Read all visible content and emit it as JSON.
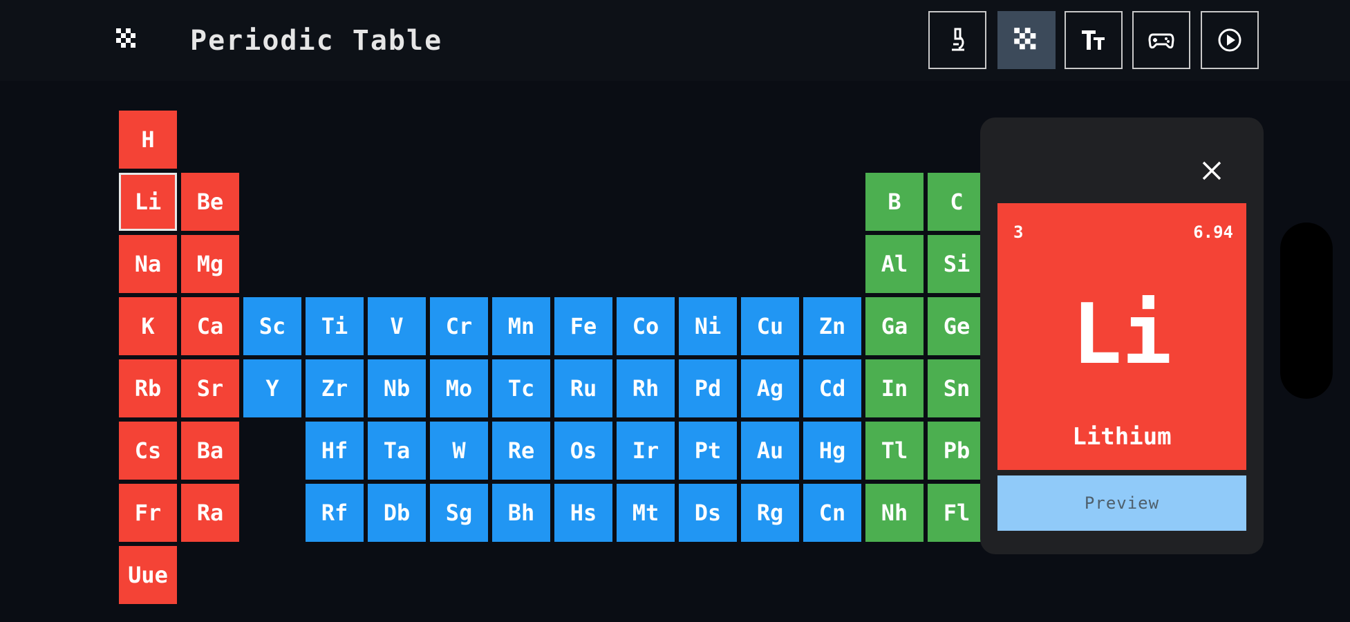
{
  "app": {
    "title": "Periodic Table"
  },
  "toolbar": {
    "buttons": [
      {
        "name": "lab-button",
        "icon": "microscope-icon",
        "active": false
      },
      {
        "name": "table-button",
        "icon": "grid-icon",
        "active": true
      },
      {
        "name": "text-size-button",
        "icon": "text-size-icon",
        "active": false
      },
      {
        "name": "game-button",
        "icon": "gamepad-icon",
        "active": false
      },
      {
        "name": "play-button",
        "icon": "play-circle-icon",
        "active": false
      }
    ]
  },
  "colors": {
    "alkali": "#f44336",
    "transition": "#2196f3",
    "post": "#4caf50",
    "selected_outline": "#e8e8e8"
  },
  "elements": [
    {
      "symbol": "H",
      "group": "alkali",
      "col": 1,
      "row": 1
    },
    {
      "symbol": "Li",
      "group": "alkali",
      "col": 1,
      "row": 2,
      "selected": true
    },
    {
      "symbol": "Be",
      "group": "alkali",
      "col": 2,
      "row": 2
    },
    {
      "symbol": "B",
      "group": "post",
      "col": 13,
      "row": 2
    },
    {
      "symbol": "C",
      "group": "post",
      "col": 14,
      "row": 2
    },
    {
      "symbol": "Na",
      "group": "alkali",
      "col": 1,
      "row": 3
    },
    {
      "symbol": "Mg",
      "group": "alkali",
      "col": 2,
      "row": 3
    },
    {
      "symbol": "Al",
      "group": "post",
      "col": 13,
      "row": 3
    },
    {
      "symbol": "Si",
      "group": "post",
      "col": 14,
      "row": 3
    },
    {
      "symbol": "K",
      "group": "alkali",
      "col": 1,
      "row": 4
    },
    {
      "symbol": "Ca",
      "group": "alkali",
      "col": 2,
      "row": 4
    },
    {
      "symbol": "Sc",
      "group": "transition",
      "col": 3,
      "row": 4
    },
    {
      "symbol": "Ti",
      "group": "transition",
      "col": 4,
      "row": 4
    },
    {
      "symbol": "V",
      "group": "transition",
      "col": 5,
      "row": 4
    },
    {
      "symbol": "Cr",
      "group": "transition",
      "col": 6,
      "row": 4
    },
    {
      "symbol": "Mn",
      "group": "transition",
      "col": 7,
      "row": 4
    },
    {
      "symbol": "Fe",
      "group": "transition",
      "col": 8,
      "row": 4
    },
    {
      "symbol": "Co",
      "group": "transition",
      "col": 9,
      "row": 4
    },
    {
      "symbol": "Ni",
      "group": "transition",
      "col": 10,
      "row": 4
    },
    {
      "symbol": "Cu",
      "group": "transition",
      "col": 11,
      "row": 4
    },
    {
      "symbol": "Zn",
      "group": "transition",
      "col": 12,
      "row": 4
    },
    {
      "symbol": "Ga",
      "group": "post",
      "col": 13,
      "row": 4
    },
    {
      "symbol": "Ge",
      "group": "post",
      "col": 14,
      "row": 4
    },
    {
      "symbol": "Rb",
      "group": "alkali",
      "col": 1,
      "row": 5
    },
    {
      "symbol": "Sr",
      "group": "alkali",
      "col": 2,
      "row": 5
    },
    {
      "symbol": "Y",
      "group": "transition",
      "col": 3,
      "row": 5
    },
    {
      "symbol": "Zr",
      "group": "transition",
      "col": 4,
      "row": 5
    },
    {
      "symbol": "Nb",
      "group": "transition",
      "col": 5,
      "row": 5
    },
    {
      "symbol": "Mo",
      "group": "transition",
      "col": 6,
      "row": 5
    },
    {
      "symbol": "Tc",
      "group": "transition",
      "col": 7,
      "row": 5
    },
    {
      "symbol": "Ru",
      "group": "transition",
      "col": 8,
      "row": 5
    },
    {
      "symbol": "Rh",
      "group": "transition",
      "col": 9,
      "row": 5
    },
    {
      "symbol": "Pd",
      "group": "transition",
      "col": 10,
      "row": 5
    },
    {
      "symbol": "Ag",
      "group": "transition",
      "col": 11,
      "row": 5
    },
    {
      "symbol": "Cd",
      "group": "transition",
      "col": 12,
      "row": 5
    },
    {
      "symbol": "In",
      "group": "post",
      "col": 13,
      "row": 5
    },
    {
      "symbol": "Sn",
      "group": "post",
      "col": 14,
      "row": 5
    },
    {
      "symbol": "Cs",
      "group": "alkali",
      "col": 1,
      "row": 6
    },
    {
      "symbol": "Ba",
      "group": "alkali",
      "col": 2,
      "row": 6
    },
    {
      "symbol": "Hf",
      "group": "transition",
      "col": 4,
      "row": 6
    },
    {
      "symbol": "Ta",
      "group": "transition",
      "col": 5,
      "row": 6
    },
    {
      "symbol": "W",
      "group": "transition",
      "col": 6,
      "row": 6
    },
    {
      "symbol": "Re",
      "group": "transition",
      "col": 7,
      "row": 6
    },
    {
      "symbol": "Os",
      "group": "transition",
      "col": 8,
      "row": 6
    },
    {
      "symbol": "Ir",
      "group": "transition",
      "col": 9,
      "row": 6
    },
    {
      "symbol": "Pt",
      "group": "transition",
      "col": 10,
      "row": 6
    },
    {
      "symbol": "Au",
      "group": "transition",
      "col": 11,
      "row": 6
    },
    {
      "symbol": "Hg",
      "group": "transition",
      "col": 12,
      "row": 6
    },
    {
      "symbol": "Tl",
      "group": "post",
      "col": 13,
      "row": 6
    },
    {
      "symbol": "Pb",
      "group": "post",
      "col": 14,
      "row": 6
    },
    {
      "symbol": "Fr",
      "group": "alkali",
      "col": 1,
      "row": 7
    },
    {
      "symbol": "Ra",
      "group": "alkali",
      "col": 2,
      "row": 7
    },
    {
      "symbol": "Rf",
      "group": "transition",
      "col": 4,
      "row": 7
    },
    {
      "symbol": "Db",
      "group": "transition",
      "col": 5,
      "row": 7
    },
    {
      "symbol": "Sg",
      "group": "transition",
      "col": 6,
      "row": 7
    },
    {
      "symbol": "Bh",
      "group": "transition",
      "col": 7,
      "row": 7
    },
    {
      "symbol": "Hs",
      "group": "transition",
      "col": 8,
      "row": 7
    },
    {
      "symbol": "Mt",
      "group": "transition",
      "col": 9,
      "row": 7
    },
    {
      "symbol": "Ds",
      "group": "transition",
      "col": 10,
      "row": 7
    },
    {
      "symbol": "Rg",
      "group": "transition",
      "col": 11,
      "row": 7
    },
    {
      "symbol": "Cn",
      "group": "transition",
      "col": 12,
      "row": 7
    },
    {
      "symbol": "Nh",
      "group": "post",
      "col": 13,
      "row": 7
    },
    {
      "symbol": "Fl",
      "group": "post",
      "col": 14,
      "row": 7
    },
    {
      "symbol": "Uue",
      "group": "alkali",
      "col": 1,
      "row": 8
    }
  ],
  "detail": {
    "number": "3",
    "mass": "6.94",
    "symbol": "Li",
    "name": "Lithium",
    "preview_label": "Preview",
    "close_icon": "close-icon"
  }
}
